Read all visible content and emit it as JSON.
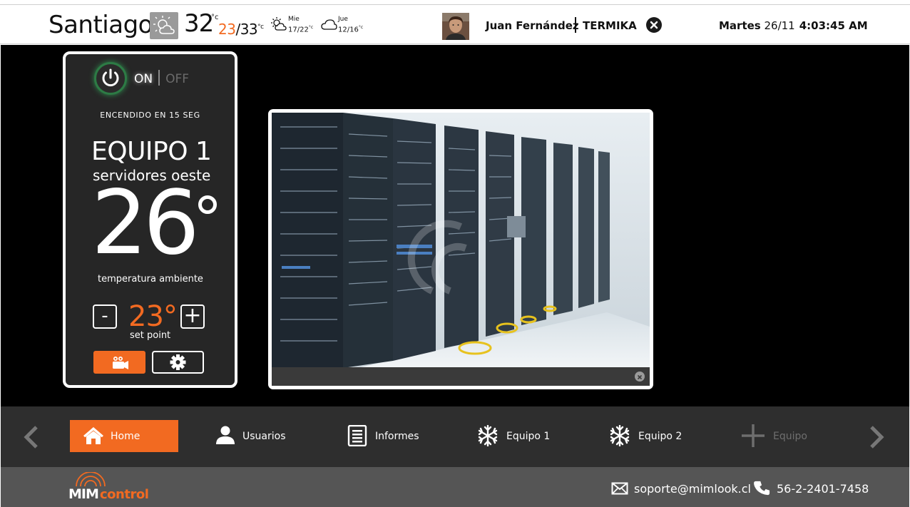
{
  "header": {
    "city": "Santiago",
    "weather_icon": "sun-cloud-icon",
    "temp_now": "32",
    "temp_unit": "°c",
    "temp_low": "23",
    "temp_high": "/33",
    "temp_range_unit": "°c",
    "forecast": [
      {
        "day": "Mie",
        "range": "17/22",
        "unit": "°c",
        "icon": "partly-sunny-icon"
      },
      {
        "day": "Jue",
        "range": "12/16",
        "unit": "°c",
        "icon": "cloud-icon"
      }
    ],
    "user_name": "Juan Fernández",
    "company": "TERMIKA",
    "date_dow": "Martes",
    "date_day": "26/11",
    "time": "4:03:45 AM"
  },
  "panel": {
    "on_label": "ON",
    "off_label": "OFF",
    "status": "ENCENDIDO EN 15 SEG",
    "equipo_name": "EQUIPO 1",
    "equipo_sub": "servidores oeste",
    "ambient_temp": "26",
    "ambient_label": "temperatura ambiente",
    "minus_label": "-",
    "plus_label": "+",
    "setpoint": "23°",
    "setpoint_label": "set point"
  },
  "nav": {
    "items": [
      {
        "label": "Home",
        "icon": "home-icon"
      },
      {
        "label": "Usuarios",
        "icon": "user-icon"
      },
      {
        "label": "Informes",
        "icon": "document-icon"
      },
      {
        "label": "Equipo 1",
        "icon": "snowflake-icon"
      },
      {
        "label": "Equipo 2",
        "icon": "snowflake-icon"
      },
      {
        "label": "Equipo",
        "icon": "plus-icon"
      }
    ]
  },
  "footer": {
    "email": "soporte@mimlook.cl",
    "phone": "56-2-2401-7458"
  },
  "colors": {
    "accent": "#f26a21",
    "power_ring": "#2f8f4f",
    "background": "#000000",
    "nav_bg": "#2e2e2e",
    "footer_bg": "#555555"
  }
}
